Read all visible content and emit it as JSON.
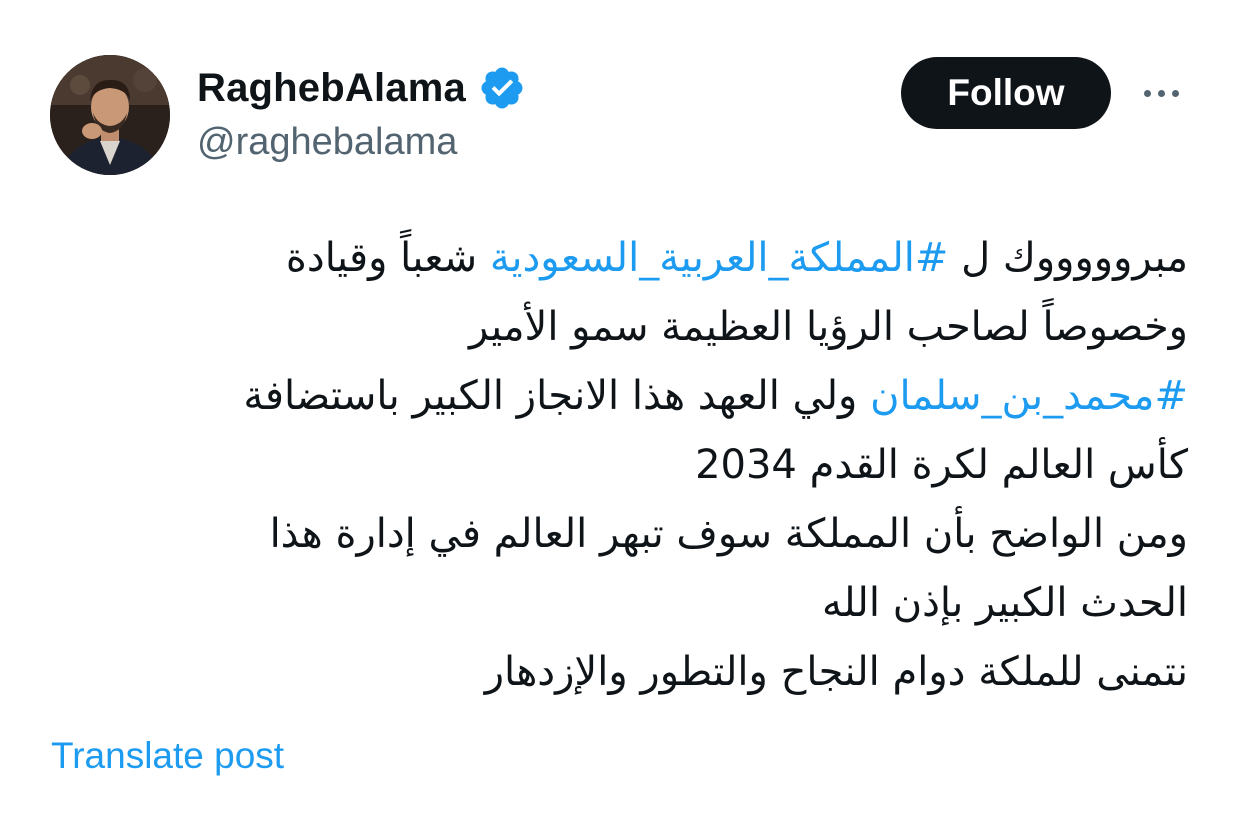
{
  "user": {
    "display_name": "RaghebAlama",
    "handle": "@raghebalama",
    "verified_icon": "verified-badge-icon",
    "avatar": "profile-photo"
  },
  "actions": {
    "follow_label": "Follow",
    "more_icon": "more-options-icon"
  },
  "post": {
    "line1_before": "مبروووووك ل ",
    "hashtag1": "#المملكة_العربية_السعودية",
    "line1_after": " شعباً وقيادة",
    "line2": "وخصوصاً لصاحب الرؤيا العظيمة سمو الأمير",
    "hashtag2": "#محمد_بن_سلمان",
    "line3_after": " ولي العهد هذا الانجاز الكبير  باستضافة",
    "line4": "كأس العالم لكرة القدم 2034",
    "line5": "ومن الواضح بأن المملكة سوف تبهر العالم في إدارة هذا",
    "line6": "الحدث الكبير بإذن الله",
    "line7": "نتمنى للملكة دوام النجاح والتطور والإزدهار"
  },
  "translate_label": "Translate post",
  "colors": {
    "text": "#0f1419",
    "secondary": "#536471",
    "link": "#1d9bf0",
    "follow_bg": "#0f1419"
  }
}
